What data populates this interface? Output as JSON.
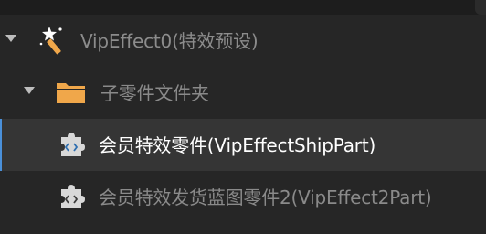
{
  "tree": {
    "items": [
      {
        "label": "VipEffect0(特效预设)",
        "icon": "magic-wand-icon",
        "expanded": true
      },
      {
        "label": "子零件文件夹",
        "icon": "folder-icon",
        "expanded": true
      },
      {
        "label": "会员特效零件(VipEffectShipPart)",
        "icon": "code-puzzle-icon",
        "selected": true
      },
      {
        "label": "会员特效发货蓝图零件2(VipEffect2Part)",
        "icon": "code-puzzle-icon"
      }
    ]
  },
  "colors": {
    "background": "#262626",
    "selected_row": "#353535",
    "selection_accent": "#4a90d9",
    "folder": "#f0a74a",
    "puzzle": "#d8d8d8"
  }
}
